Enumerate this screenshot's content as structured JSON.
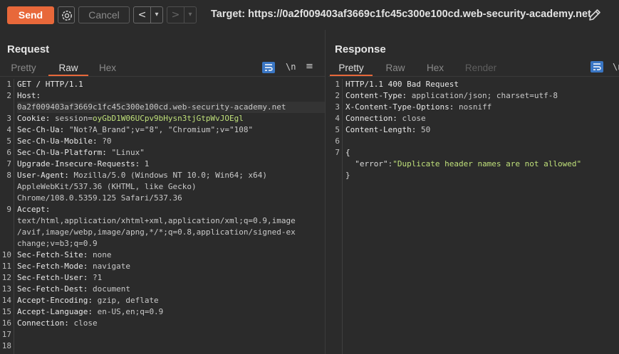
{
  "toolbar": {
    "send_label": "Send",
    "cancel_label": "Cancel",
    "back_label": "<",
    "forward_label": ">",
    "dropdown_glyph": "▾",
    "target_text": "Target: https://0a2f009403af3669c1fc45c300e100cd.web-security-academy.net"
  },
  "request": {
    "title": "Request",
    "tabs": [
      "Pretty",
      "Raw",
      "Hex"
    ],
    "active_tab": "Raw",
    "newline_label": "\\n",
    "menu_glyph": "≡",
    "line_numbers": [
      "1",
      "2",
      "",
      "3",
      "4",
      "5",
      "6",
      "7",
      "8",
      "",
      "",
      "9",
      "",
      "",
      "",
      "10",
      "11",
      "12",
      "13",
      "14",
      "15",
      "16",
      "17",
      "18"
    ],
    "lines": [
      {
        "k": "GET / HTTP/1.1",
        "v": ""
      },
      {
        "k": "Host:",
        "v": ""
      },
      {
        "k": "",
        "v": "0a2f009403af3669c1fc45c300e100cd.web-security-academy.net"
      },
      {
        "k": "Cookie:",
        "v": " session=",
        "c": "oyGbD1W06UCpv9bHysn3tjGtpWvJOEgl"
      },
      {
        "k": "Sec-Ch-Ua:",
        "v": " \"Not?A_Brand\";v=\"8\", \"Chromium\";v=\"108\""
      },
      {
        "k": "Sec-Ch-Ua-Mobile:",
        "v": " ?0"
      },
      {
        "k": "Sec-Ch-Ua-Platform:",
        "v": " \"Linux\""
      },
      {
        "k": "Upgrade-Insecure-Requests:",
        "v": " 1"
      },
      {
        "k": "User-Agent:",
        "v": " Mozilla/5.0 (Windows NT 10.0; Win64; x64)"
      },
      {
        "k": "",
        "v": "AppleWebKit/537.36 (KHTML, like Gecko)"
      },
      {
        "k": "",
        "v": "Chrome/108.0.5359.125 Safari/537.36"
      },
      {
        "k": "Accept:",
        "v": ""
      },
      {
        "k": "",
        "v": "text/html,application/xhtml+xml,application/xml;q=0.9,image"
      },
      {
        "k": "",
        "v": "/avif,image/webp,image/apng,*/*;q=0.8,application/signed-ex"
      },
      {
        "k": "",
        "v": "change;v=b3;q=0.9"
      },
      {
        "k": "Sec-Fetch-Site:",
        "v": " none"
      },
      {
        "k": "Sec-Fetch-Mode:",
        "v": " navigate"
      },
      {
        "k": "Sec-Fetch-User:",
        "v": " ?1"
      },
      {
        "k": "Sec-Fetch-Dest:",
        "v": " document"
      },
      {
        "k": "Accept-Encoding:",
        "v": " gzip, deflate"
      },
      {
        "k": "Accept-Language:",
        "v": " en-US,en;q=0.9"
      },
      {
        "k": "Connection:",
        "v": " close"
      },
      {
        "k": "",
        "v": ""
      },
      {
        "k": "",
        "v": ""
      }
    ]
  },
  "response": {
    "title": "Response",
    "tabs": [
      "Pretty",
      "Raw",
      "Hex",
      "Render"
    ],
    "active_tab": "Pretty",
    "newline_label": "\\n",
    "line_numbers": [
      "1",
      "2",
      "3",
      "4",
      "5",
      "6",
      "7",
      "",
      "",
      ""
    ],
    "lines": [
      {
        "k": "HTTP/1.1 400 Bad Request",
        "v": ""
      },
      {
        "k": "Content-Type:",
        "v": " application/json; charset=utf-8"
      },
      {
        "k": "X-Content-Type-Options:",
        "v": " nosniff"
      },
      {
        "k": "Connection:",
        "v": " close"
      },
      {
        "k": "Content-Length:",
        "v": " 50"
      },
      {
        "k": "",
        "v": ""
      },
      {
        "k": "{",
        "v": ""
      }
    ],
    "json_key": "\"error\"",
    "json_sep": ":",
    "json_value": "\"Duplicate header names are not allowed\"",
    "json_close": "}"
  },
  "colors": {
    "accent": "#e8683a",
    "selected_blue": "#3a76c4",
    "string_green": "#bfe07a"
  },
  "icons": {
    "settings": "gear-icon",
    "edit_target": "pencil-icon",
    "wrap": "wrap-lines-icon",
    "layout": "split-layout-icon"
  }
}
